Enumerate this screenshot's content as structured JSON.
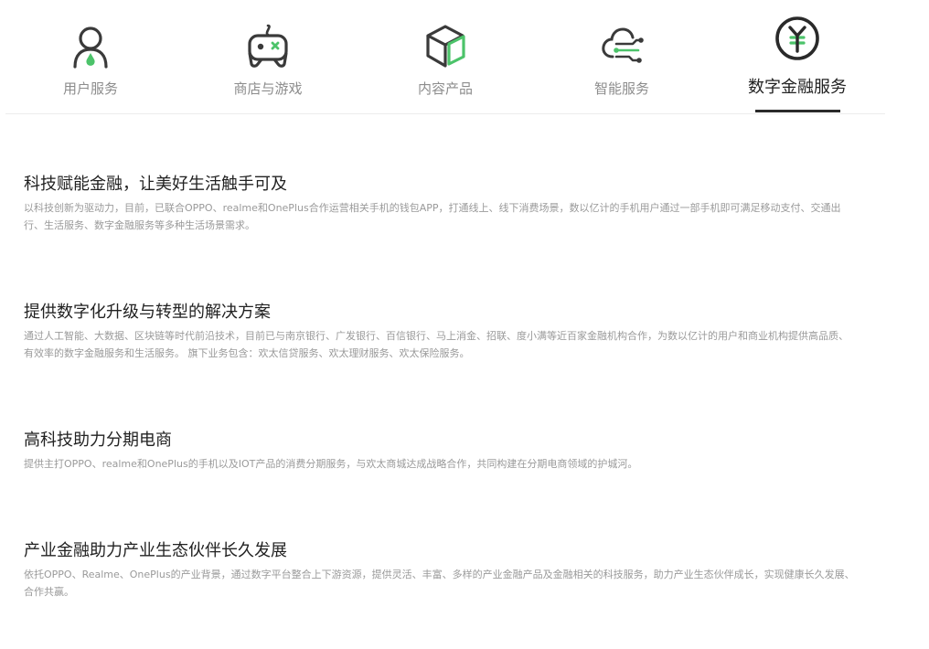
{
  "tabs": [
    {
      "label": "用户服务",
      "icon": "user-icon",
      "active": false
    },
    {
      "label": "商店与游戏",
      "icon": "gamepad-icon",
      "active": false
    },
    {
      "label": "内容产品",
      "icon": "cube-icon",
      "active": false
    },
    {
      "label": "智能服务",
      "icon": "cloud-circuit-icon",
      "active": false
    },
    {
      "label": "数字金融服务",
      "icon": "yuan-coin-icon",
      "active": true
    }
  ],
  "colors": {
    "icon_stroke": "#3a3a3a",
    "accent_green": "#4cc36a",
    "active_text": "#222222",
    "inactive_text": "#8c8c8c",
    "description_text": "#9a9a9a"
  },
  "sections": [
    {
      "title": "科技赋能金融，让美好生活触手可及",
      "description": "以科技创新为驱动力，目前，已联合OPPO、realme和OnePlus合作运营相关手机的钱包APP，打通线上、线下消费场景，数以亿计的手机用户通过一部手机即可满足移动支付、交通出行、生活服务、数字金融服务等多种生活场景需求。"
    },
    {
      "title": "提供数字化升级与转型的解决方案",
      "description": "通过人工智能、大数据、区块链等时代前沿技术，目前已与南京银行、广发银行、百信银行、马上消金、招联、度小满等近百家金融机构合作，为数以亿计的用户和商业机构提供高品质、有效率的数字金融服务和生活服务。 旗下业务包含：欢太信贷服务、欢太理财服务、欢太保险服务。"
    },
    {
      "title": "高科技助力分期电商",
      "description": "提供主打OPPO、realme和OnePlus的手机以及IOT产品的消费分期服务，与欢太商城达成战略合作，共同构建在分期电商领域的护城河。"
    },
    {
      "title": "产业金融助力产业生态伙伴长久发展",
      "description": "依托OPPO、Realme、OnePlus的产业背景，通过数字平台整合上下游资源，提供灵活、丰富、多样的产业金融产品及金融相关的科技服务，助力产业生态伙伴成长，实现健康长久发展、合作共赢。"
    }
  ]
}
